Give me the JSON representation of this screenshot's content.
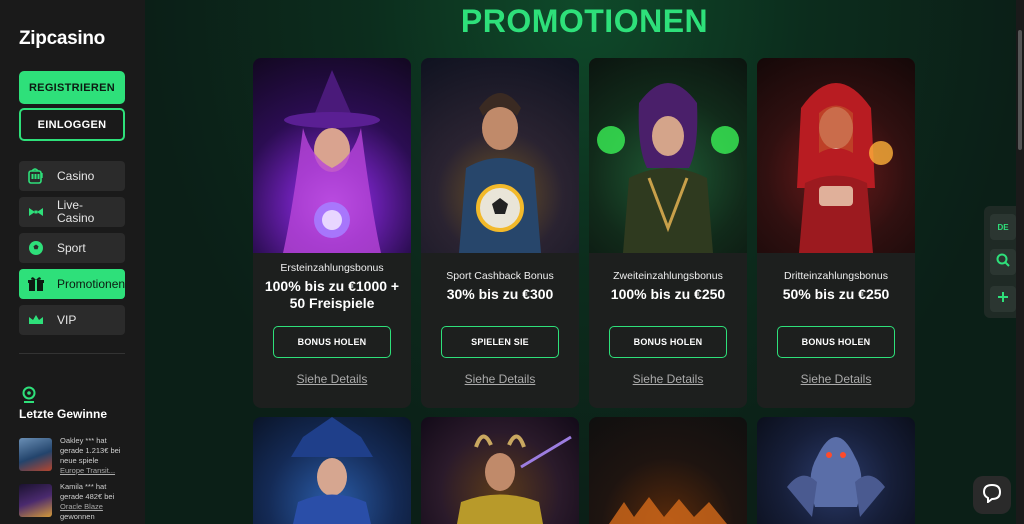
{
  "brand": {
    "logo_prefix": "Zip",
    "logo_suffix": "casino"
  },
  "auth": {
    "register_label": "REGISTRIEREN",
    "login_label": "EINLOGGEN"
  },
  "nav": {
    "items": [
      {
        "label": "Casino",
        "icon": "slot-machine-icon",
        "active": false
      },
      {
        "label": "Live-\nCasino",
        "icon": "bowtie-icon",
        "active": false
      },
      {
        "label": "Sport",
        "icon": "soccer-ball-icon",
        "active": false
      },
      {
        "label": "Promotionen",
        "icon": "gift-icon",
        "active": true
      },
      {
        "label": "VIP",
        "icon": "crown-icon",
        "active": false
      }
    ]
  },
  "winners": {
    "title": "Letzte Gewinne",
    "list": [
      {
        "line1": "Oakley *** hat",
        "line2": "gerade 1.213€ bei",
        "line3": "neue spiele",
        "game": "Europe Transit..."
      },
      {
        "line1": "Kamila *** hat",
        "line2": "gerade 482€ bei",
        "game": "Oracle Blaze",
        "line4": "gewonnen"
      }
    ]
  },
  "page": {
    "title": "PROMOTIONEN"
  },
  "promotions": [
    {
      "subtitle": "Ersteinzahlungsbonus",
      "headline": "100% bis zu €1000 + 50 Freispiele",
      "cta": "BONUS HOLEN",
      "details": "Siehe Details"
    },
    {
      "subtitle": "Sport Cashback Bonus",
      "headline": "30% bis zu €300",
      "cta": "SPIELEN SIE",
      "details": "Siehe Details"
    },
    {
      "subtitle": "Zweiteinzahlungsbonus",
      "headline": "100% bis zu €250",
      "cta": "BONUS HOLEN",
      "details": "Siehe Details"
    },
    {
      "subtitle": "Dritteinzahlungsbonus",
      "headline": "50% bis zu €250",
      "cta": "BONUS HOLEN",
      "details": "Siehe Details"
    }
  ],
  "rail": {
    "language": "DE"
  },
  "colors": {
    "accent": "#2ee07a",
    "sidebar": "#1a1a1a",
    "card": "#1d1f1e"
  }
}
